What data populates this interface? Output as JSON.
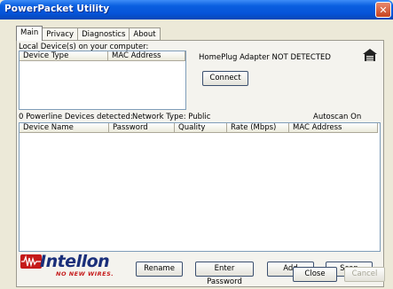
{
  "window": {
    "title": "PowerPacket Utility",
    "close_glyph": "✕"
  },
  "tabs": [
    {
      "label": "Main",
      "active": true
    },
    {
      "label": "Privacy",
      "active": false
    },
    {
      "label": "Diagnostics",
      "active": false
    },
    {
      "label": "About",
      "active": false
    }
  ],
  "local": {
    "section_label": "Local Device(s) on your computer:",
    "columns": [
      "Device Type",
      "MAC Address"
    ],
    "status": "HomePlug Adapter NOT DETECTED",
    "connect_label": "Connect",
    "icon": "house-network-icon"
  },
  "powerline": {
    "count_label": "0 Powerline Devices detected:",
    "network_type": "Network Type: Public",
    "autoscan": "Autoscan On",
    "columns": [
      "Device Name",
      "Password",
      "Quality",
      "Rate (Mbps)",
      "MAC Address"
    ]
  },
  "logo": {
    "brand": "Intellon",
    "tagline": "NO NEW WIRES."
  },
  "buttons": {
    "rename": "Rename",
    "enter_password": "Enter Password",
    "add": "Add",
    "scan": "Scan",
    "close": "Close",
    "cancel": "Cancel"
  },
  "colors": {
    "titlebar": "#0553d8",
    "brand_blue": "#1a2f7a",
    "brand_red": "#c51a1a"
  }
}
